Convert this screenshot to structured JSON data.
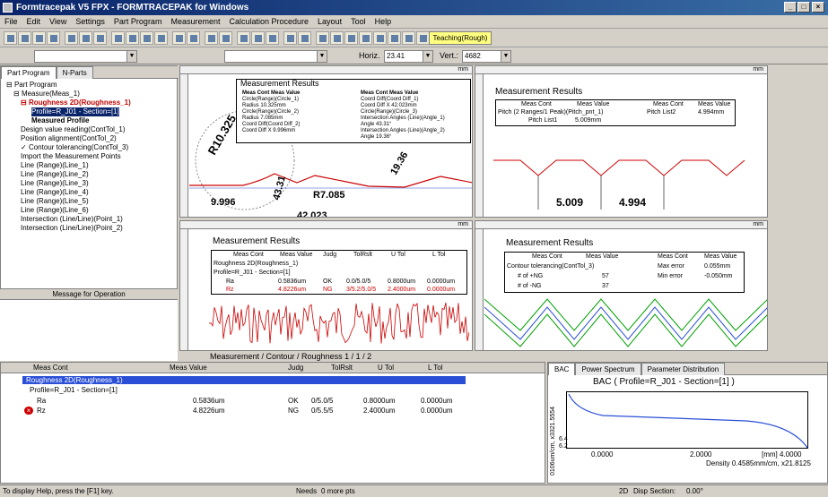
{
  "window": {
    "title": "Formtracepak V5 FPX - FORMTRACEPAK for Windows"
  },
  "menu": [
    "File",
    "Edit",
    "View",
    "Settings",
    "Part Program",
    "Measurement",
    "Calculation Procedure",
    "Layout",
    "Tool",
    "Help"
  ],
  "toolbar": {
    "horiz_label": "Horiz.",
    "horiz_value": "23.41",
    "vert_label": "Vert.:",
    "vert_value": "4682",
    "teaching": "Teaching(Rough)"
  },
  "left": {
    "tabs": [
      "Part Program",
      "N-Parts"
    ],
    "tree": [
      "Part Program",
      "Measure(Meas_1)",
      "Roughness 2D(Roughness_1)",
      "Profile=R_J01 - Section=[1]",
      "Measured Profile",
      "Design value reading(ContTol_1)",
      "Position alignment(ContTol_2)",
      "Contour tolerancing(ContTol_3)",
      "Import the Measurement Points",
      "Line (Range)(Line_1)",
      "Line (Range)(Line_2)",
      "Line (Range)(Line_3)",
      "Line (Range)(Line_4)",
      "Line (Range)(Line_5)",
      "Line (Range)(Line_6)",
      "Intersection (Line/Line)(Point_1)",
      "Intersection (Line/Line)(Point_2)"
    ],
    "message_header": "Message for Operation"
  },
  "pane1": {
    "ruler_unit": "mm",
    "results_title": "Measurement Results",
    "headers": [
      "Meas Cont",
      "Meas Value",
      "Meas Cont",
      "Meas Value"
    ],
    "rows": [
      [
        "Circle(Range)(Circle_1)",
        "",
        "Coord Diff(Coord Diff_1)",
        ""
      ],
      [
        "Radius",
        "10.325mm",
        "Coord Diff X",
        "42.023mm"
      ],
      [
        "Circle(Range)(Circle_2)",
        "",
        "Circle(Range)(Circle_3)",
        ""
      ],
      [
        "Radius",
        "7.085mm",
        "Intersection Angles (Line)(Angle_1)",
        ""
      ],
      [
        "Coord Diff(Coord Diff_2)",
        "",
        "Angle",
        "43.31°"
      ],
      [
        "Coord Diff X",
        "9.996mm",
        "Intersection Angles (Line)(Angle_2)",
        ""
      ],
      [
        "",
        "",
        "Angle",
        "19.36°"
      ]
    ],
    "dims": [
      "R10.325",
      "9.996",
      "43.31",
      "R7.085",
      "42.023",
      "19.36"
    ]
  },
  "pane2": {
    "results_title": "Measurement Results",
    "headers": [
      "Meas Cont",
      "Meas Value",
      "Meas Cont",
      "Meas Value"
    ],
    "rows": [
      [
        "Pitch (2 Ranges/1 Peak)(Pitch_pnt_1)",
        "",
        "Pitch List2",
        "4.994mm"
      ],
      [
        "Pitch List1",
        "5.009mm",
        "",
        ""
      ]
    ],
    "dims": [
      "5.009",
      "4.994"
    ]
  },
  "pane3": {
    "results_title": "Measurement Results",
    "headers": [
      "Meas Cont",
      "Meas Value",
      "Judg",
      "TolRslt",
      "U Tol",
      "L Tol"
    ],
    "rows": [
      [
        "Roughness 2D(Roughness_1)",
        "",
        "",
        "",
        "",
        ""
      ],
      [
        "Profile=R_J01 - Section=[1]",
        "",
        "",
        "",
        "",
        ""
      ],
      [
        "Ra",
        "0.5836um",
        "OK",
        "0.0/5.0/5",
        "0.8000um",
        "0.0000um"
      ],
      [
        "Rz",
        "4.8226um",
        "NG",
        "3/5.2/5.0/5",
        "2.4000um",
        "0.0000um"
      ]
    ]
  },
  "pane4": {
    "results_title": "Measurement Results",
    "headers": [
      "Meas Cont",
      "Meas Value",
      "Meas Cont",
      "Meas Value"
    ],
    "rows": [
      [
        "Contour tolerancing(ContTol_3)",
        "",
        "Max error",
        "0.055mm"
      ],
      [
        "# of +NG",
        "57",
        "Min error",
        "-0.050mm"
      ],
      [
        "# of -NG",
        "37",
        "",
        ""
      ]
    ]
  },
  "bottom_tabs": "Measurement / Contour / Roughness 1 / 1 / 2",
  "grid": {
    "headers": [
      "Meas Cont",
      "Meas Value",
      "Judg",
      "TolRslt",
      "U Tol",
      "L Tol"
    ],
    "rows": [
      [
        "Roughness 2D(Roughness_1)",
        "",
        "",
        "",
        "",
        ""
      ],
      [
        "Profile=R_J01 - Section=[1]",
        "",
        "",
        "",
        "",
        ""
      ],
      [
        "Ra",
        "0.5836um",
        "OK",
        "0/5.0/5",
        "0.8000um",
        "0.0000um"
      ],
      [
        "Rz",
        "4.8226um",
        "NG",
        "0/5.5/5",
        "2.4000um",
        "0.0000um"
      ]
    ]
  },
  "analysis": {
    "tabs": [
      "BAC",
      "Power Spectrum",
      "Parameter Distribution"
    ],
    "title": "BAC ( Profile=R_J01 - Section=[1] )",
    "ylabel": "0106um/cm, x3321.5554",
    "xticks": [
      "0.0000",
      "2.0000",
      "[mm] 4.0000"
    ],
    "density": "Density 0.4585mm/cm, x21.8125",
    "yvals": [
      "6.4",
      "6.2"
    ]
  },
  "status": {
    "help": "To display Help, press the [F1] key.",
    "needs": "Needs",
    "more": "0 more pts",
    "mode": "2D",
    "disp": "Disp Section:",
    "angle": "0.00°"
  },
  "colors": {
    "titlebar": "#0a246a",
    "select": "#0a246a",
    "profile": "#cc0000",
    "tolband": "#00a000",
    "accent": "#2a4fd6"
  }
}
